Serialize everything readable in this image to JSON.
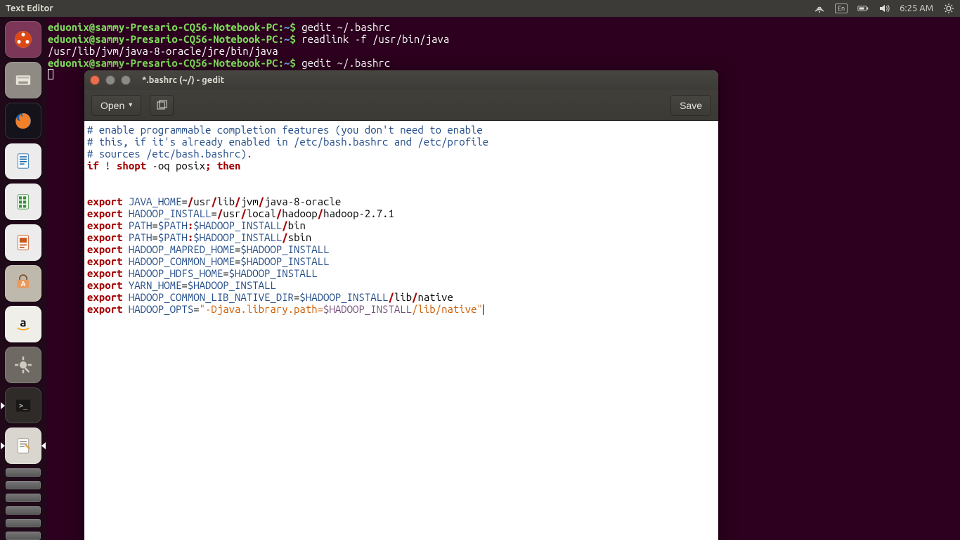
{
  "menubar": {
    "app_title": "Text Editor",
    "lang": "En",
    "time": "6:25 AM"
  },
  "terminal": {
    "prompt_user": "eduonix@sammy-Presario-CQ56-Notebook-PC",
    "prompt_path": "~",
    "lines": [
      {
        "cmd": "gedit ~/.bashrc"
      },
      {
        "cmd": "readlink -f /usr/bin/java"
      },
      {
        "out": "/usr/lib/jvm/java-8-oracle/jre/bin/java"
      },
      {
        "cmd": "gedit ~/.bashrc"
      }
    ]
  },
  "gedit": {
    "title": "*.bashrc (~/) - gedit",
    "open_label": "Open",
    "save_label": "Save",
    "code": {
      "comment1": "# enable programmable completion features (you don't need to enable",
      "comment2": "# this, if it's already enabled in /etc/bash.bashrc and /etc/profile",
      "comment3": "# sources /etc/bash.bashrc).",
      "ifline_if": "if",
      "ifline_bang": " ! ",
      "ifline_shopt": "shopt",
      "ifline_rest": " -oq posix",
      "ifline_semi": "; ",
      "ifline_then": "then",
      "exports": [
        {
          "name": "JAVA_HOME",
          "eq": "=",
          "segs": [
            "/",
            "usr",
            "/",
            "lib",
            "/",
            "jvm",
            "/",
            "java-8-oracle"
          ]
        },
        {
          "name": "HADOOP_INSTALL",
          "eq": "=",
          "segs": [
            "/",
            "usr",
            "/",
            "local",
            "/",
            "hadoop",
            "/",
            "hadoop-2.7.1"
          ]
        },
        {
          "name": "PATH",
          "eq": "=",
          "var": "$PATH",
          "colon": ":",
          "var2": "$HADOOP_INSTALL",
          "tail": [
            "/",
            "bin"
          ]
        },
        {
          "name": "PATH",
          "eq": "=",
          "var": "$PATH",
          "colon": ":",
          "var2": "$HADOOP_INSTALL",
          "tail": [
            "/",
            "sbin"
          ]
        },
        {
          "name": "HADOOP_MAPRED_HOME",
          "eq": "=",
          "var": "$HADOOP_INSTALL"
        },
        {
          "name": "HADOOP_COMMON_HOME",
          "eq": "=",
          "var": "$HADOOP_INSTALL"
        },
        {
          "name": "HADOOP_HDFS_HOME",
          "eq": "=",
          "var": "$HADOOP_INSTALL"
        },
        {
          "name": "YARN_HOME",
          "eq": "=",
          "var": "$HADOOP_INSTALL"
        },
        {
          "name": "HADOOP_COMMON_LIB_NATIVE_DIR",
          "eq": "=",
          "var": "$HADOOP_INSTALL",
          "tail": [
            "/",
            "lib",
            "/",
            "native"
          ]
        },
        {
          "name": "HADOOP_OPTS",
          "eq": "=",
          "str_open": "\"",
          "str_lit": "-Djava.library.path=",
          "str_var": "$HADOOP_INSTALL",
          "str_lit2": "/lib/native",
          "str_close": "\""
        }
      ]
    }
  },
  "launcher": {
    "items": [
      {
        "name": "dash",
        "color": "#dd4814"
      },
      {
        "name": "files",
        "color": "#8a7f7a"
      },
      {
        "name": "firefox",
        "color": "#1b66b1"
      },
      {
        "name": "writer",
        "color": "#1d6caa"
      },
      {
        "name": "calc",
        "color": "#3b8e3b"
      },
      {
        "name": "impress",
        "color": "#c8541e"
      },
      {
        "name": "software",
        "color": "#e47635"
      },
      {
        "name": "amazon",
        "color": "#e6e6e6"
      },
      {
        "name": "settings",
        "color": "#6e6a63"
      },
      {
        "name": "terminal",
        "color": "#2e2b28"
      },
      {
        "name": "gedit",
        "color": "#d9d6cf"
      }
    ]
  }
}
